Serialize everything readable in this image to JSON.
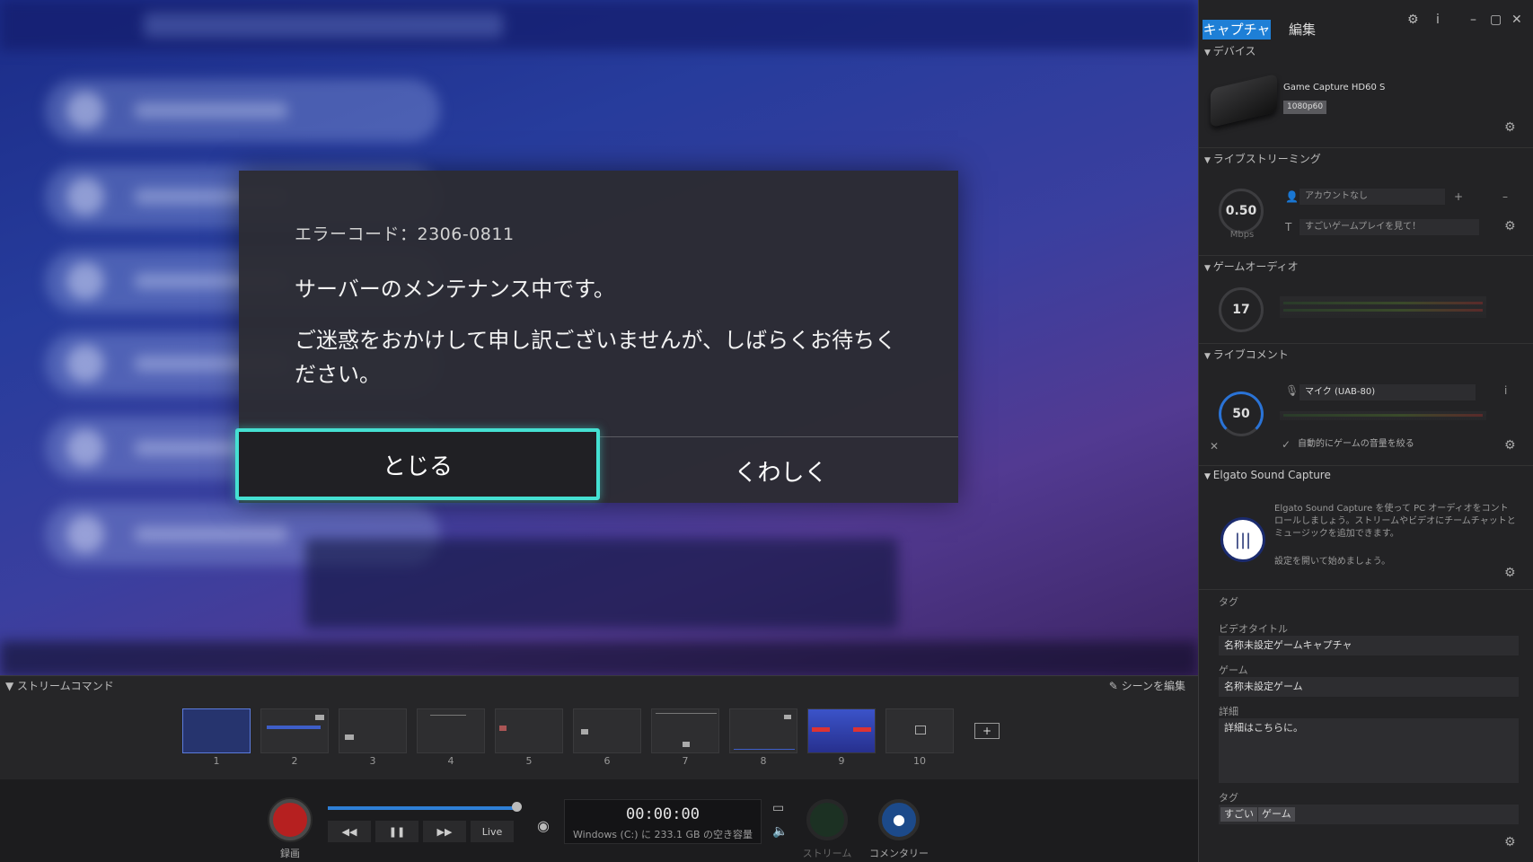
{
  "modal": {
    "error_code": "エラーコード：2306-0811",
    "main_message": "サーバーのメンテナンス中です。",
    "sub_message": "ご迷惑をおかけして申し訳ございませんが、しばらくお待ちください。",
    "close_label": "とじる",
    "details_label": "くわしく"
  },
  "scenes": {
    "header": "ストリームコマンド",
    "edit_label": "シーンを編集",
    "items": [
      "1",
      "2",
      "3",
      "4",
      "5",
      "6",
      "7",
      "8",
      "9",
      "10"
    ],
    "add_label": "+"
  },
  "transport": {
    "record_label": "録画",
    "rewind": "◀◀",
    "pause": "❚❚",
    "forward": "▶▶",
    "live": "Live",
    "timer": "00:00:00",
    "disk_space": "Windows (C:) に 233.1 GB の空き容量",
    "stream_label": "ストリーム",
    "commentary_label": "コメンタリー",
    "progress": 1.0
  },
  "panel": {
    "tab_capture": "キャプチャ",
    "tab_edit": "編集",
    "device": {
      "header": "デバイス",
      "name": "Game Capture HD60 S",
      "resolution": "1080p60"
    },
    "live_streaming": {
      "header": "ライブストリーミング",
      "bitrate": "0.50",
      "unit": "Mbps",
      "account": "アカウントなし",
      "title": "すごいゲームプレイを見て！"
    },
    "game_audio": {
      "header": "ゲームオーディオ",
      "level": "17"
    },
    "live_commentary": {
      "header": "ライブコメント",
      "level": "50",
      "mic": "マイク (UAB-80)",
      "auto_lower": "自動的にゲームの音量を絞る"
    },
    "sound_capture": {
      "header": "Elgato Sound Capture",
      "description": "Elgato Sound Capture を使って PC オーディオをコントロールしましょう。ストリームやビデオにチームチャットとミュージックを追加できます。",
      "start": "設定を開いて始めましょう。"
    },
    "tags_section": {
      "header": "タグ",
      "video_title_label": "ビデオタイトル",
      "video_title": "名称未設定ゲームキャプチャ",
      "game_label": "ゲーム",
      "game": "名称未設定ゲーム",
      "details_label": "詳細",
      "details": "詳細はこちらに。",
      "tags_label": "タグ",
      "tags": [
        "すごい",
        "ゲーム"
      ]
    }
  },
  "colors": {
    "accent_blue": "#1e7fd6",
    "focus_teal": "#45e0d2",
    "record_red": "#b62020"
  }
}
